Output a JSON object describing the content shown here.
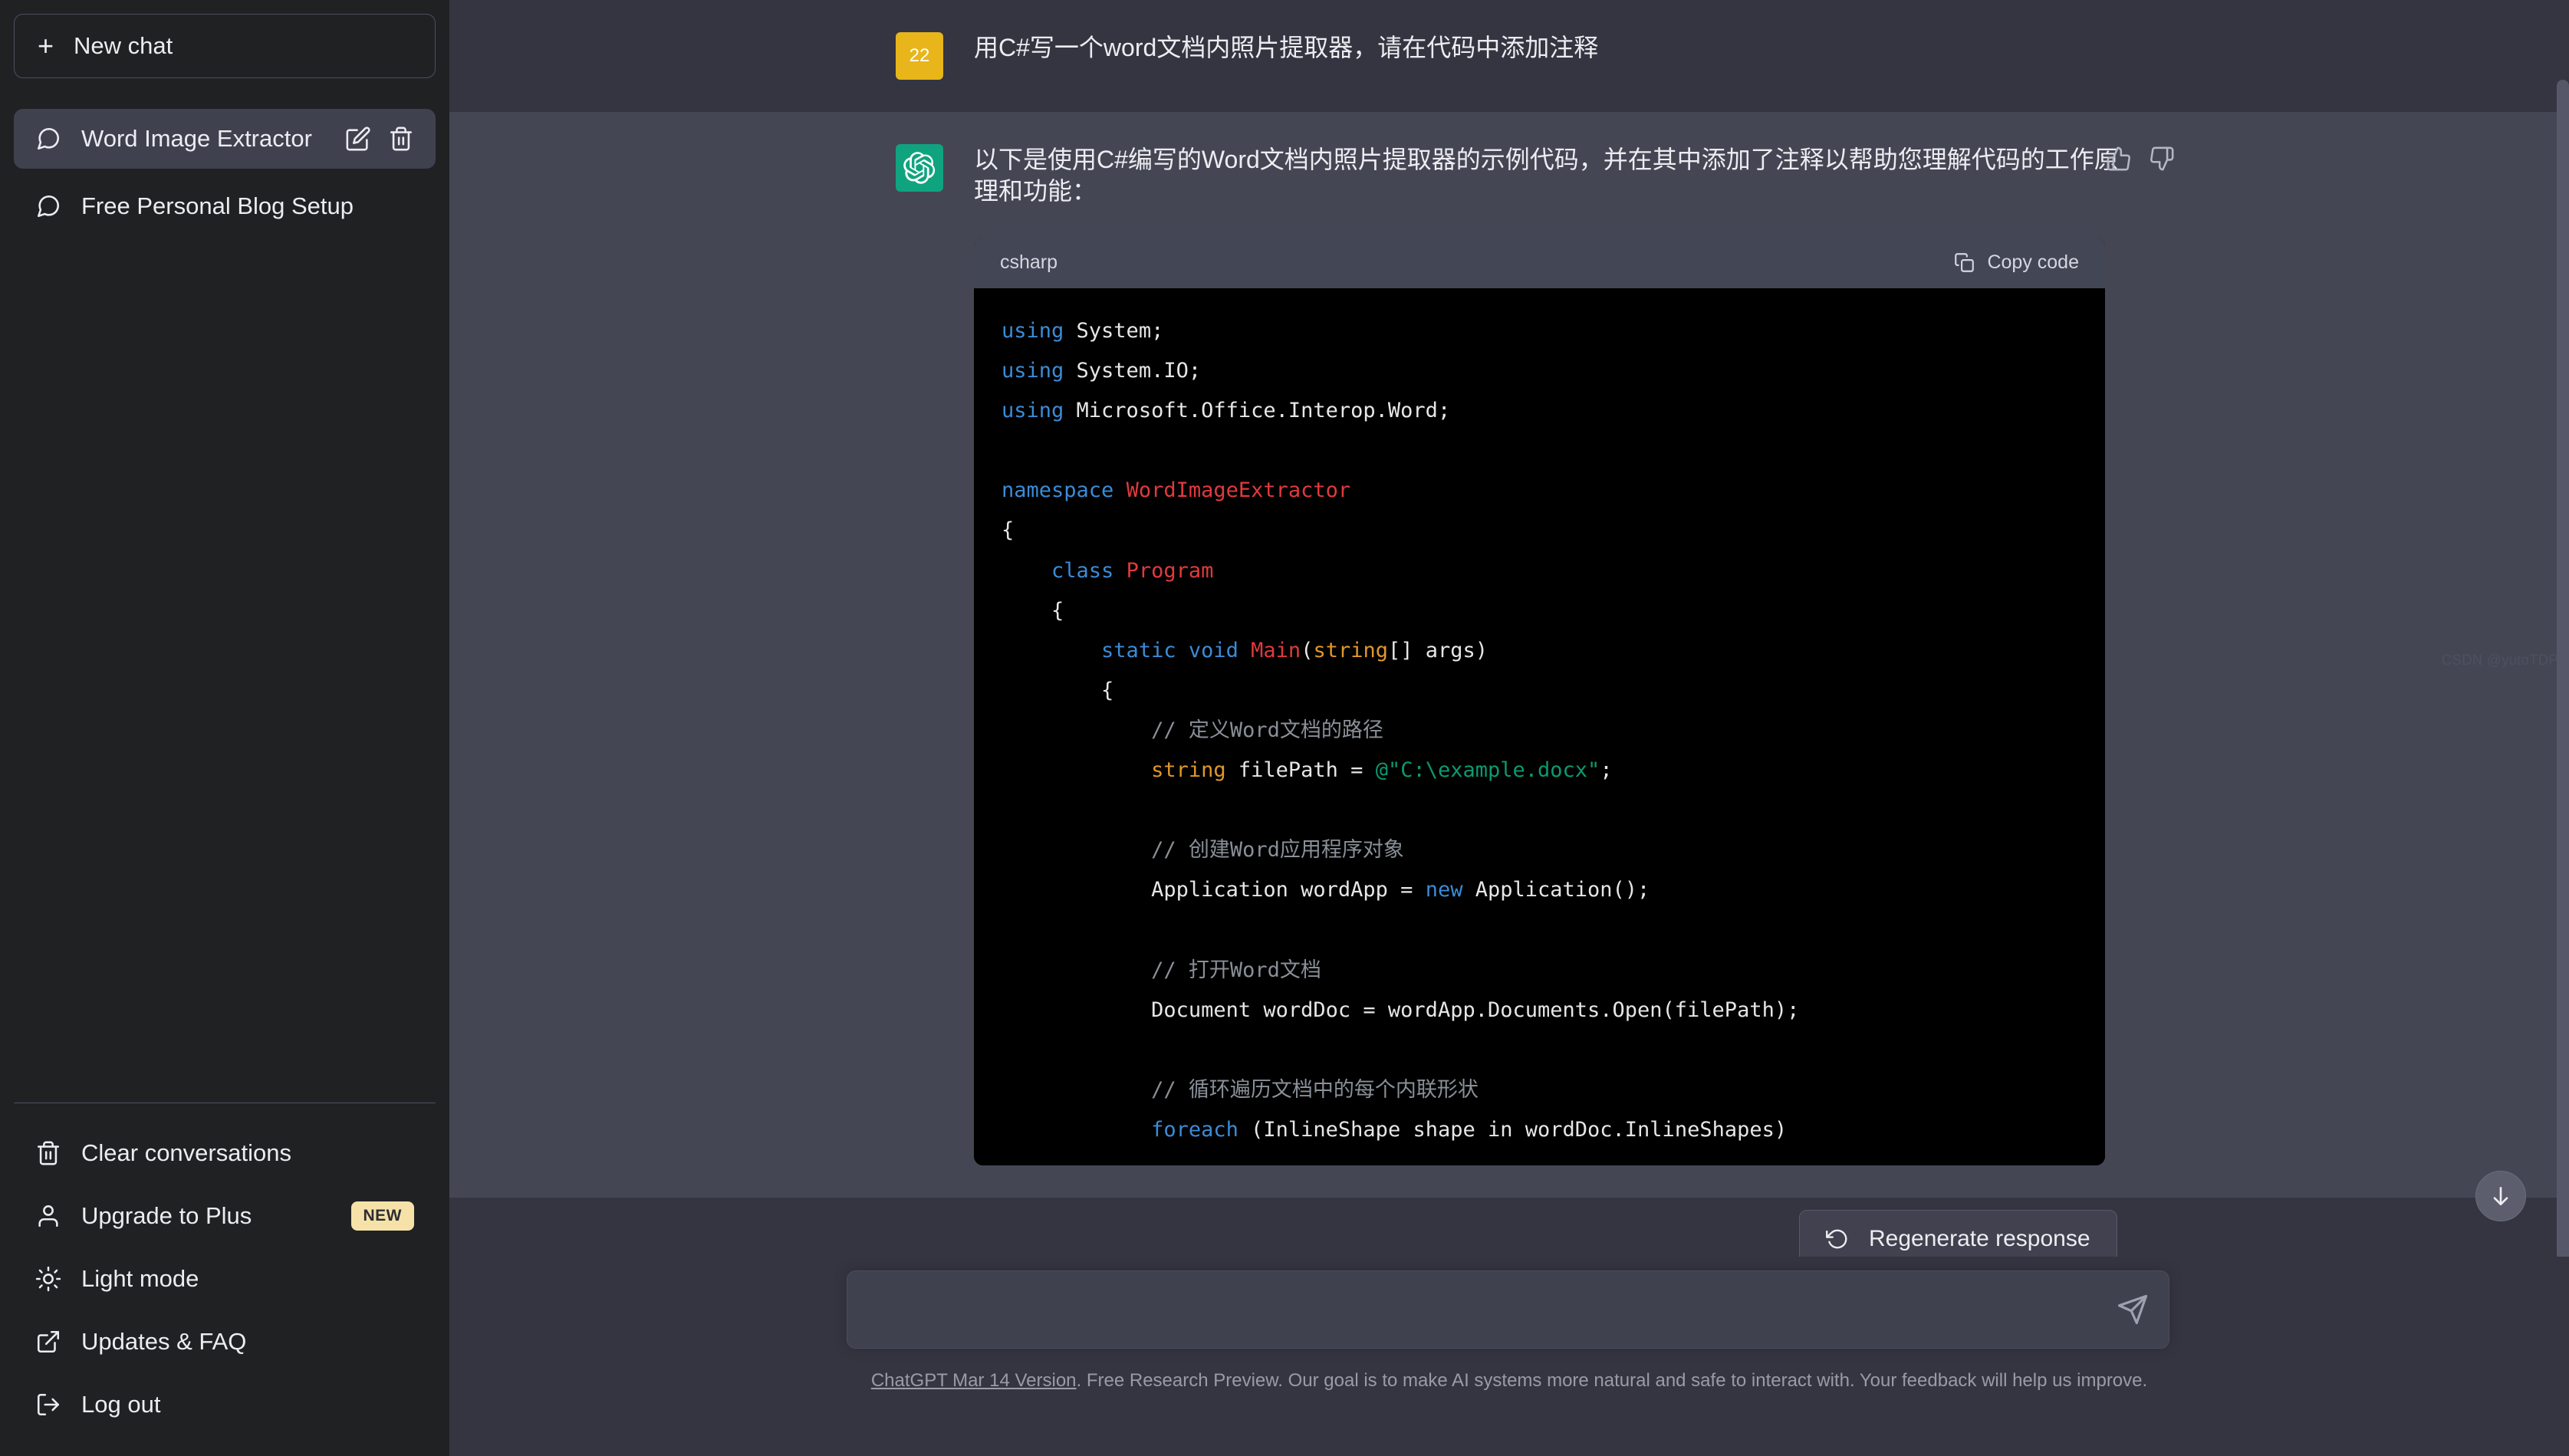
{
  "sidebar": {
    "new_chat_label": "New chat",
    "conversations": [
      {
        "label": "Word Image Extractor",
        "active": true
      },
      {
        "label": "Free Personal Blog Setup",
        "active": false
      }
    ],
    "footer_items": [
      {
        "label": "Clear conversations",
        "icon": "trash-icon",
        "badge": ""
      },
      {
        "label": "Upgrade to Plus",
        "icon": "user-icon",
        "badge": "NEW"
      },
      {
        "label": "Light mode",
        "icon": "sun-icon",
        "badge": ""
      },
      {
        "label": "Updates & FAQ",
        "icon": "external-link-icon",
        "badge": ""
      },
      {
        "label": "Log out",
        "icon": "logout-icon",
        "badge": ""
      }
    ]
  },
  "conversation": {
    "user_message": {
      "avatar_text": "22",
      "text": "用C#写一个word文档内照片提取器，请在代码中添加注释"
    },
    "assistant_message": {
      "text": "以下是使用C#编写的Word文档内照片提取器的示例代码，并在其中添加了注释以帮助您理解代码的工作原理和功能："
    }
  },
  "code_block": {
    "language": "csharp",
    "copy_label": "Copy code",
    "lines": [
      [
        {
          "t": "using",
          "c": "k-blue"
        },
        {
          "t": " System;",
          "c": ""
        }
      ],
      [
        {
          "t": "using",
          "c": "k-blue"
        },
        {
          "t": " System.IO;",
          "c": ""
        }
      ],
      [
        {
          "t": "using",
          "c": "k-blue"
        },
        {
          "t": " Microsoft.Office.Interop.Word;",
          "c": ""
        }
      ],
      [
        {
          "t": "",
          "c": ""
        }
      ],
      [
        {
          "t": "namespace",
          "c": "k-blue"
        },
        {
          "t": " ",
          "c": ""
        },
        {
          "t": "WordImageExtractor",
          "c": "k-red"
        }
      ],
      [
        {
          "t": "{",
          "c": ""
        }
      ],
      [
        {
          "t": "    ",
          "c": ""
        },
        {
          "t": "class",
          "c": "k-blue"
        },
        {
          "t": " ",
          "c": ""
        },
        {
          "t": "Program",
          "c": "k-red"
        }
      ],
      [
        {
          "t": "    {",
          "c": ""
        }
      ],
      [
        {
          "t": "        ",
          "c": ""
        },
        {
          "t": "static",
          "c": "k-blue"
        },
        {
          "t": " ",
          "c": ""
        },
        {
          "t": "void",
          "c": "k-blue"
        },
        {
          "t": " ",
          "c": ""
        },
        {
          "t": "Main",
          "c": "k-red"
        },
        {
          "t": "(",
          "c": ""
        },
        {
          "t": "string",
          "c": "k-orange"
        },
        {
          "t": "[] args)",
          "c": ""
        }
      ],
      [
        {
          "t": "        {",
          "c": ""
        }
      ],
      [
        {
          "t": "            ",
          "c": ""
        },
        {
          "t": "// 定义Word文档的路径",
          "c": "k-comment"
        }
      ],
      [
        {
          "t": "            ",
          "c": ""
        },
        {
          "t": "string",
          "c": "k-orange"
        },
        {
          "t": " filePath = ",
          "c": ""
        },
        {
          "t": "@\"C:\\example.docx\"",
          "c": "k-green"
        },
        {
          "t": ";",
          "c": ""
        }
      ],
      [
        {
          "t": "",
          "c": ""
        }
      ],
      [
        {
          "t": "            ",
          "c": ""
        },
        {
          "t": "// 创建Word应用程序对象",
          "c": "k-comment"
        }
      ],
      [
        {
          "t": "            Application wordApp = ",
          "c": ""
        },
        {
          "t": "new",
          "c": "k-blue"
        },
        {
          "t": " Application();",
          "c": ""
        }
      ],
      [
        {
          "t": "",
          "c": ""
        }
      ],
      [
        {
          "t": "            ",
          "c": ""
        },
        {
          "t": "// 打开Word文档",
          "c": "k-comment"
        }
      ],
      [
        {
          "t": "            Document wordDoc = wordApp.Documents.Open(filePath);",
          "c": ""
        }
      ],
      [
        {
          "t": "",
          "c": ""
        }
      ],
      [
        {
          "t": "            ",
          "c": ""
        },
        {
          "t": "// 循环遍历文档中的每个内联形状",
          "c": "k-comment"
        }
      ],
      [
        {
          "t": "            ",
          "c": ""
        },
        {
          "t": "foreach",
          "c": "k-blue"
        },
        {
          "t": " (InlineShape shape in wordDoc.InlineShapes)",
          "c": ""
        }
      ]
    ]
  },
  "regenerate": {
    "label": "Regenerate response",
    "icon": "refresh-icon"
  },
  "composer": {
    "value": "",
    "placeholder": "",
    "send_icon": "send-icon"
  },
  "footer": {
    "link_text": "ChatGPT Mar 14 Version",
    "note_text": ". Free Research Preview. Our goal is to make AI systems more natural and safe to interact with. Your feedback will help us improve."
  },
  "watermark": {
    "text": "CSDN @yutoTDP"
  },
  "colors": {
    "sidebar_bg": "#202123",
    "main_bg": "#343541",
    "assistant_bg": "#444654",
    "accent_green": "#10a37f",
    "accent_yellow": "#e8b51a",
    "badge_bg": "#f6e2a8",
    "code_bg": "#000000"
  }
}
